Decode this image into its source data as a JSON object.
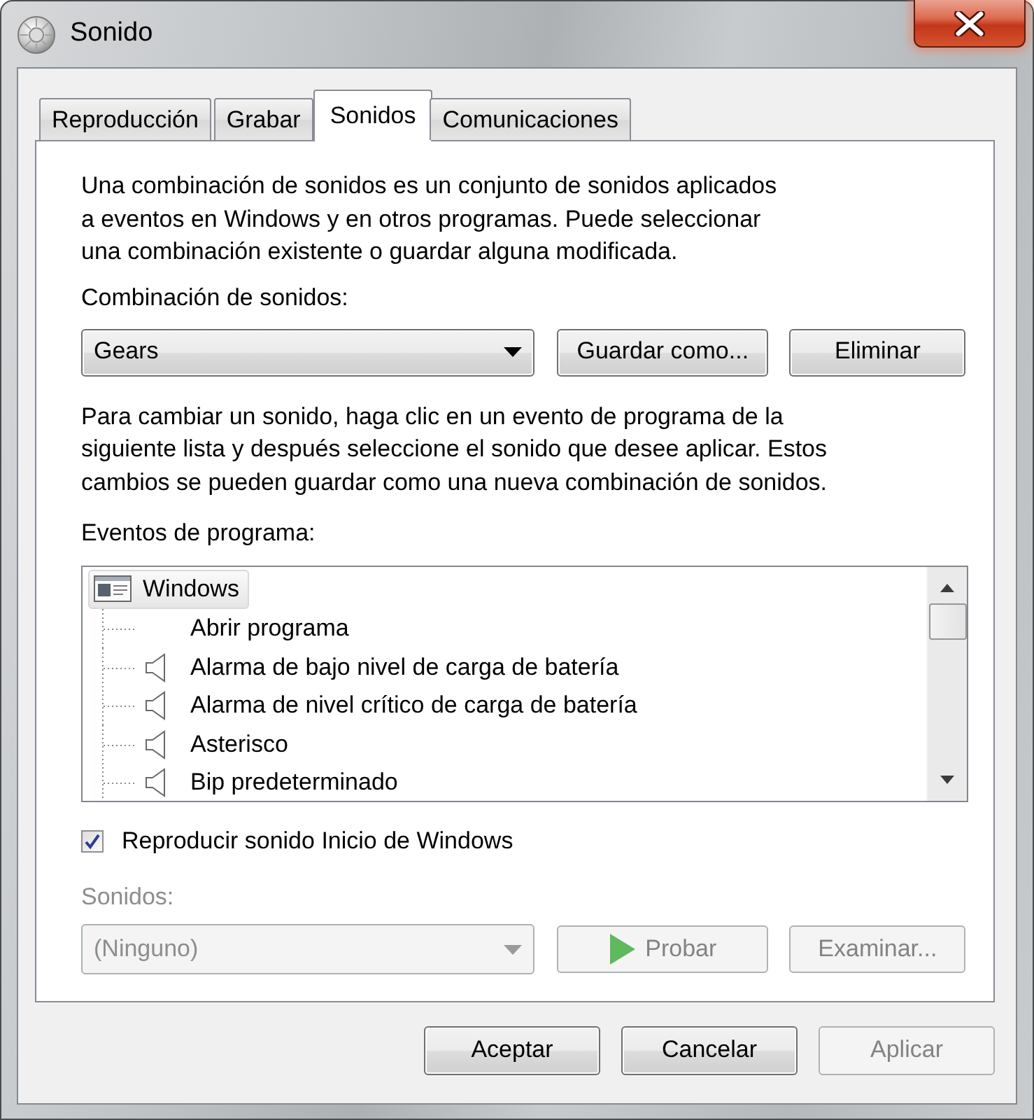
{
  "window": {
    "title": "Sonido"
  },
  "tabs": [
    {
      "label": "Reproducción",
      "selected": false
    },
    {
      "label": "Grabar",
      "selected": false
    },
    {
      "label": "Sonidos",
      "selected": true
    },
    {
      "label": "Comunicaciones",
      "selected": false
    }
  ],
  "intro": "Una combinación de sonidos es un conjunto de sonidos aplicados\na eventos en Windows y en otros programas. Puede seleccionar\nuna combinación existente o guardar alguna modificada.",
  "scheme": {
    "label": "Combinación de sonidos:",
    "value": "Gears",
    "buttons": [
      {
        "label": "Guardar como...",
        "disabled": false
      },
      {
        "label": "Eliminar",
        "disabled": false
      }
    ]
  },
  "help": "Para cambiar un sonido, haga clic en un evento de programa de la\nsiguiente lista y después seleccione el sonido que desee aplicar. Estos\ncambios se pueden guardar como una nueva combinación de sonidos.",
  "events": {
    "label": "Eventos de programa:",
    "items": [
      {
        "label": "Windows",
        "selected": true,
        "children": [
          {
            "label": "Abrir programa",
            "has_sound": false,
            "selected": false
          },
          {
            "label": "Alarma de bajo nivel de carga de batería",
            "has_sound": true,
            "selected": false
          },
          {
            "label": "Alarma de nivel crítico de carga de batería",
            "has_sound": true,
            "selected": false
          },
          {
            "label": "Asterisco",
            "has_sound": true,
            "selected": false
          },
          {
            "label": "Bip predeterminado",
            "has_sound": true,
            "selected": false
          }
        ]
      }
    ]
  },
  "startup_sound": {
    "label": "Reproducir sonido Inicio de Windows",
    "checked": true
  },
  "sound": {
    "label": "Sonidos:",
    "value": "(Ninguno)",
    "disabled": true,
    "buttons": [
      {
        "kind": "play",
        "label": "Probar",
        "disabled": true
      },
      {
        "kind": "plain",
        "label": "Examinar...",
        "disabled": true
      }
    ]
  },
  "footer_buttons": [
    {
      "label": "Aceptar",
      "disabled": false
    },
    {
      "label": "Cancelar",
      "disabled": false
    },
    {
      "label": "Aplicar",
      "disabled": true
    }
  ]
}
